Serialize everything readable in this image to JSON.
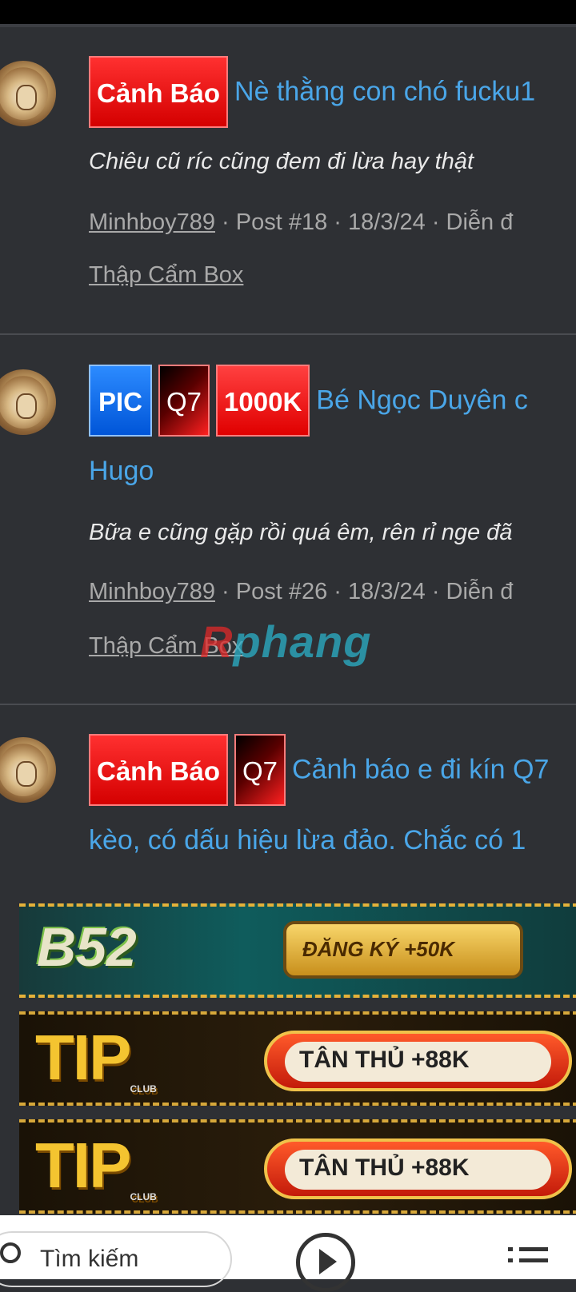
{
  "posts": [
    {
      "badges": [
        "Cảnh Báo"
      ],
      "title": "Nè thằng con chó fucku1",
      "title_line2": "",
      "snippet": "Chiêu cũ ríc cũng đem đi lừa hay thật",
      "author": "Minhboy789",
      "meta_rest": " · Post #18 · 18/3/24 · Diễn đ",
      "forum": "Thập Cẩm Box"
    },
    {
      "badges": [
        "PIC",
        "Q7",
        "1000K"
      ],
      "title": "Bé Ngọc Duyên c",
      "title_line2": "Hugo",
      "snippet": "Bữa e cũng gặp rồi quá êm, rên rỉ nge đã",
      "author": "Minhboy789",
      "meta_rest": " · Post #26 · 18/3/24 · Diễn đ",
      "forum": "Thập Cẩm Box"
    },
    {
      "badges": [
        "Cảnh Báo",
        "Q7"
      ],
      "title": "Cảnh báo e đi kín Q7",
      "title_line2": "kèo, có dấu hiệu lừa đảo. Chắc có 1"
    }
  ],
  "watermark": {
    "part1": "R",
    "part2": "phang"
  },
  "banners": {
    "b52": {
      "logo": "B52",
      "cta": "ĐĂNG KÝ +50K"
    },
    "tip1": {
      "logo": "TIP",
      "club": "CLUB",
      "cta": "TÂN THỦ +88K"
    },
    "tip2": {
      "logo": "TIP",
      "club": "CLUB",
      "cta": "TÂN THỦ +88K"
    }
  },
  "bottom_bar": {
    "search_placeholder": "Tìm kiếm"
  }
}
